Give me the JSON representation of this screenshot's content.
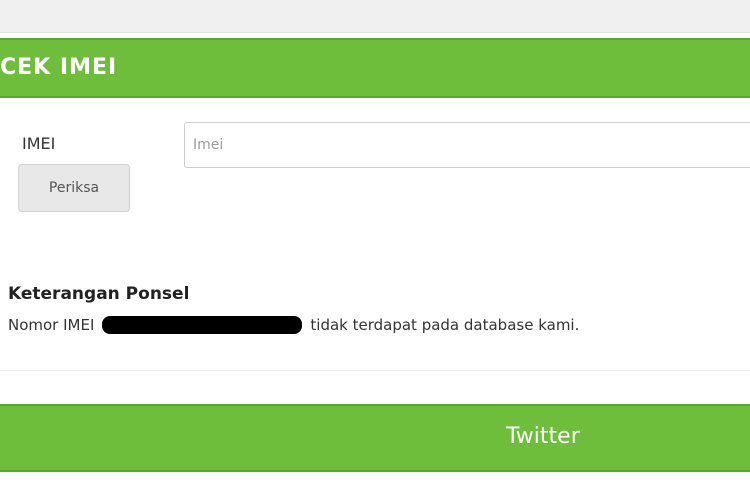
{
  "header": {
    "title": "CEK IMEI"
  },
  "form": {
    "field_label": "IMEI",
    "input_placeholder": "Imei",
    "input_value": "",
    "submit_label": "Periksa"
  },
  "result": {
    "title": "Keterangan Ponsel",
    "prefix": "Nomor IMEI",
    "suffix": "tidak terdapat pada database kami."
  },
  "footer": {
    "link_label": "Twitter"
  },
  "colors": {
    "accent_green": "#6ebe3c",
    "redaction": "#000000"
  }
}
